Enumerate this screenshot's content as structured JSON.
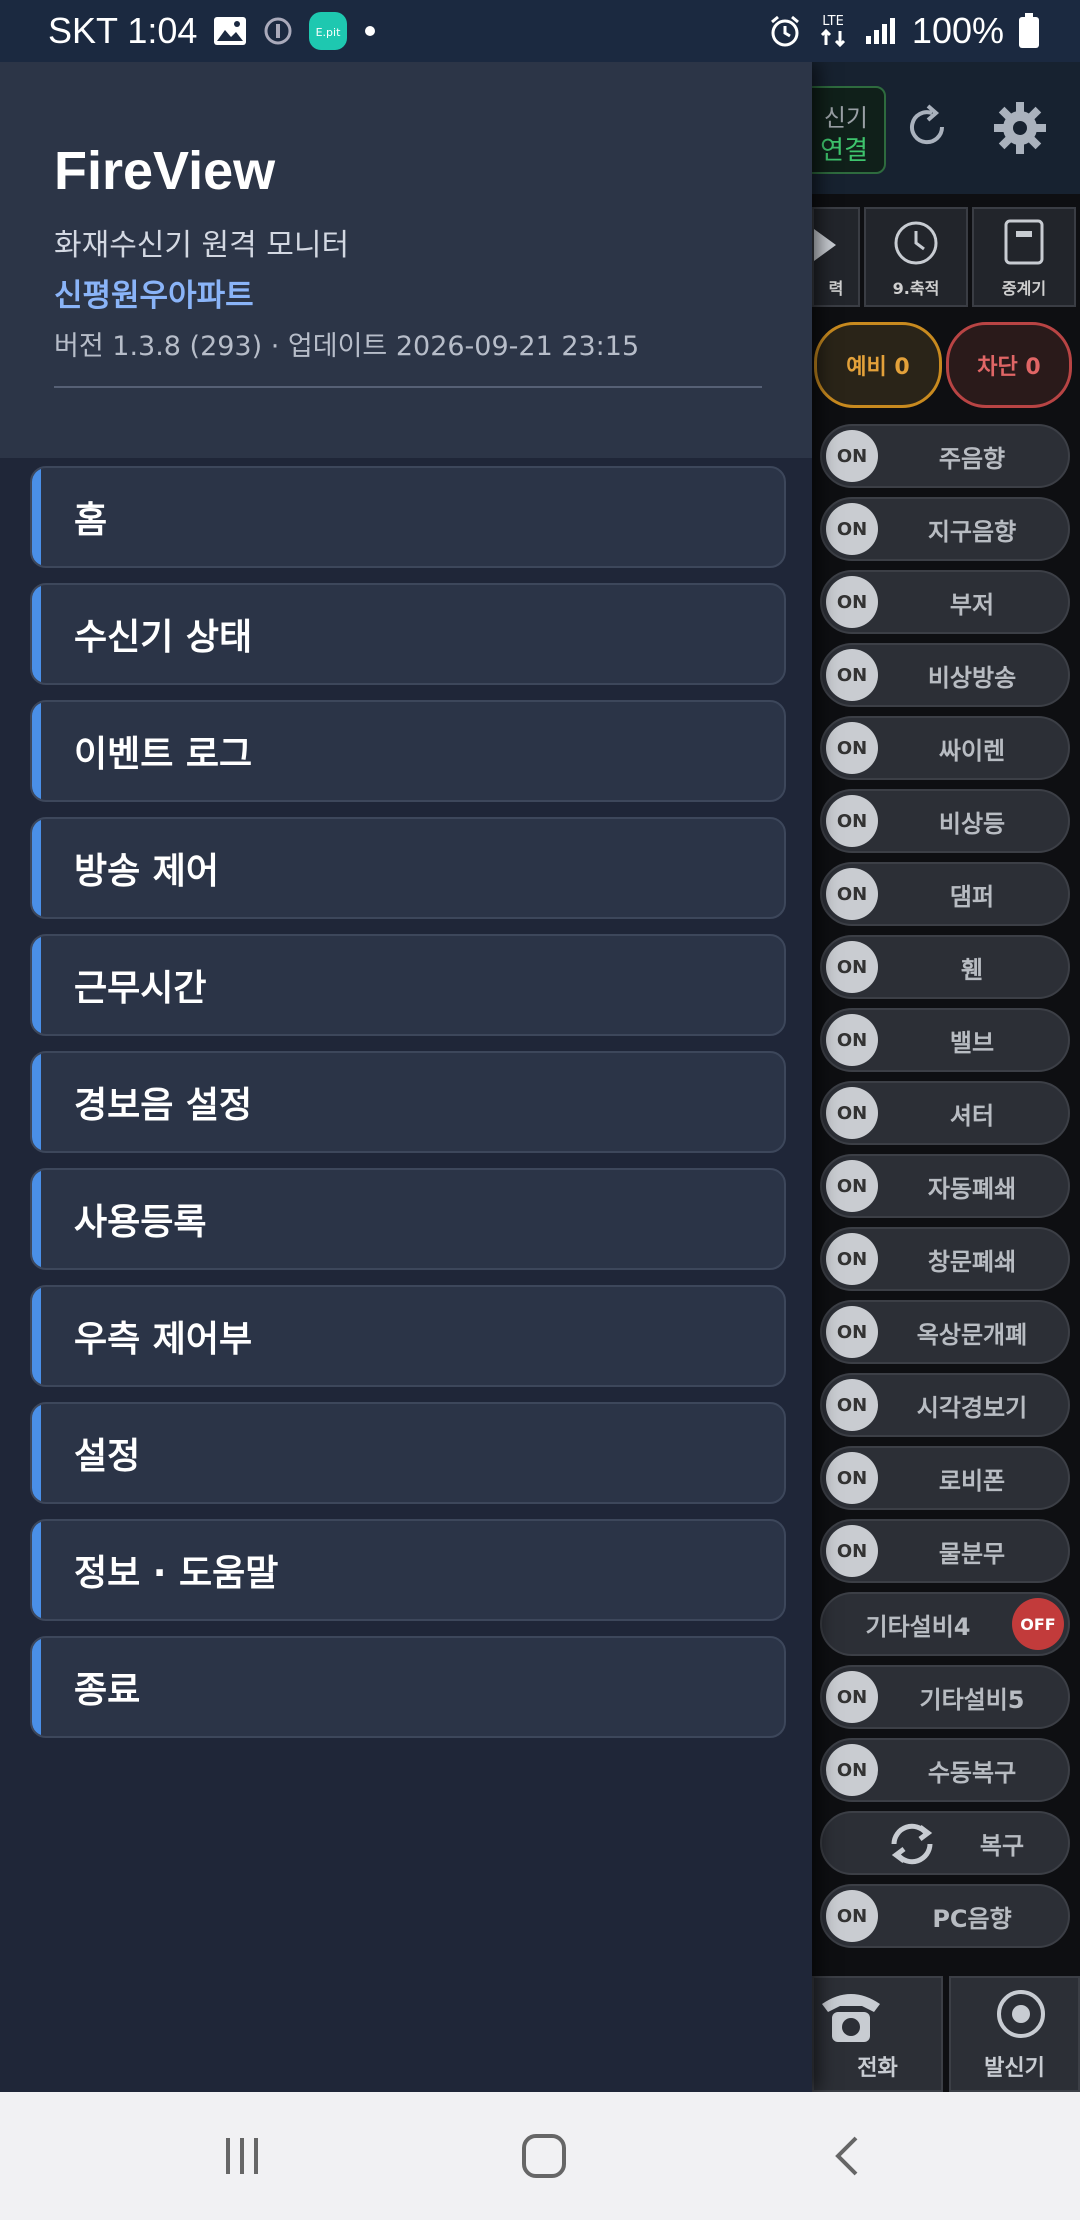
{
  "status_bar": {
    "carrier_time": "SKT 1:04",
    "network": "LTE",
    "battery": "100%",
    "notification_badge": "E.pit"
  },
  "drawer": {
    "title": "FireView",
    "subtitle": "화재수신기 원격 모니터",
    "site_name": "신평원우아파트",
    "version": "버전 1.3.8 (293)  ·  업데이트 2026-09-21 23:15",
    "accent_color": "#4a8fe7",
    "items": [
      {
        "label": "홈"
      },
      {
        "label": "수신기 상태"
      },
      {
        "label": "이벤트 로그"
      },
      {
        "label": "방송 제어"
      },
      {
        "label": "근무시간"
      },
      {
        "label": "경보음 설정"
      },
      {
        "label": "사용등록"
      },
      {
        "label": "우측 제어부"
      },
      {
        "label": "설정"
      },
      {
        "label": "정보 · 도움말"
      },
      {
        "label": "종료"
      }
    ]
  },
  "background_app": {
    "connection": {
      "line1": "신기",
      "line2": "연결"
    },
    "tabs": [
      {
        "label": "력"
      },
      {
        "label": "9.축적"
      },
      {
        "label": "중계기"
      }
    ],
    "badges": {
      "spare": "예비 0",
      "blocked": "차단 0"
    },
    "switches": [
      {
        "state": "ON",
        "label": "주음향"
      },
      {
        "state": "ON",
        "label": "지구음향"
      },
      {
        "state": "ON",
        "label": "부저"
      },
      {
        "state": "ON",
        "label": "비상방송"
      },
      {
        "state": "ON",
        "label": "싸이렌"
      },
      {
        "state": "ON",
        "label": "비상등"
      },
      {
        "state": "ON",
        "label": "댐퍼"
      },
      {
        "state": "ON",
        "label": "휀"
      },
      {
        "state": "ON",
        "label": "밸브"
      },
      {
        "state": "ON",
        "label": "셔터"
      },
      {
        "state": "ON",
        "label": "자동폐쇄"
      },
      {
        "state": "ON",
        "label": "창문폐쇄"
      },
      {
        "state": "ON",
        "label": "옥상문개폐"
      },
      {
        "state": "ON",
        "label": "시각경보기"
      },
      {
        "state": "ON",
        "label": "로비폰"
      },
      {
        "state": "ON",
        "label": "물분무"
      },
      {
        "state": "OFF",
        "label": "기타설비4"
      },
      {
        "state": "ON",
        "label": "기타설비5"
      },
      {
        "state": "ON",
        "label": "수동복구"
      }
    ],
    "reset_label": "복구",
    "pc_sound": {
      "state": "ON",
      "label": "PC음향"
    },
    "bottom_buttons": [
      {
        "label": "전화"
      },
      {
        "label": "발신기"
      }
    ]
  }
}
